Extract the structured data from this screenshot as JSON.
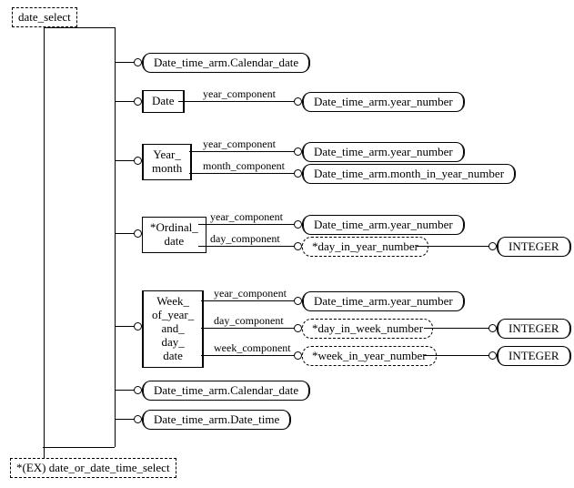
{
  "root_select": "date_select",
  "ex_select": "*(EX) date_or_date_time_select",
  "branches": {
    "cal_date_1": "Date_time_arm.Calendar_date",
    "date": {
      "label": "Date",
      "year_attr": "year_component",
      "year_target": "Date_time_arm.year_number"
    },
    "year_month": {
      "label_l1": "Year_",
      "label_l2": "month",
      "year_attr": "year_component",
      "year_target": "Date_time_arm.year_number",
      "month_attr": "month_component",
      "month_target": "Date_time_arm.month_in_year_number"
    },
    "ordinal_date": {
      "label_l1": "*Ordinal_",
      "label_l2": "date",
      "year_attr": "year_component",
      "year_target": "Date_time_arm.year_number",
      "day_attr": "day_component",
      "day_target": "*day_in_year_number",
      "integer": "INTEGER"
    },
    "week_date": {
      "label_l1": "Week_",
      "label_l2": "of_year_",
      "label_l3": "and_",
      "label_l4": "day_",
      "label_l5": "date",
      "year_attr": "year_component",
      "year_target": "Date_time_arm.year_number",
      "day_attr": "day_component",
      "day_target": "*day_in_week_number",
      "week_attr": "week_component",
      "week_target": "*week_in_year_number",
      "integer": "INTEGER"
    },
    "cal_date_2": "Date_time_arm.Calendar_date",
    "date_time": "Date_time_arm.Date_time"
  }
}
